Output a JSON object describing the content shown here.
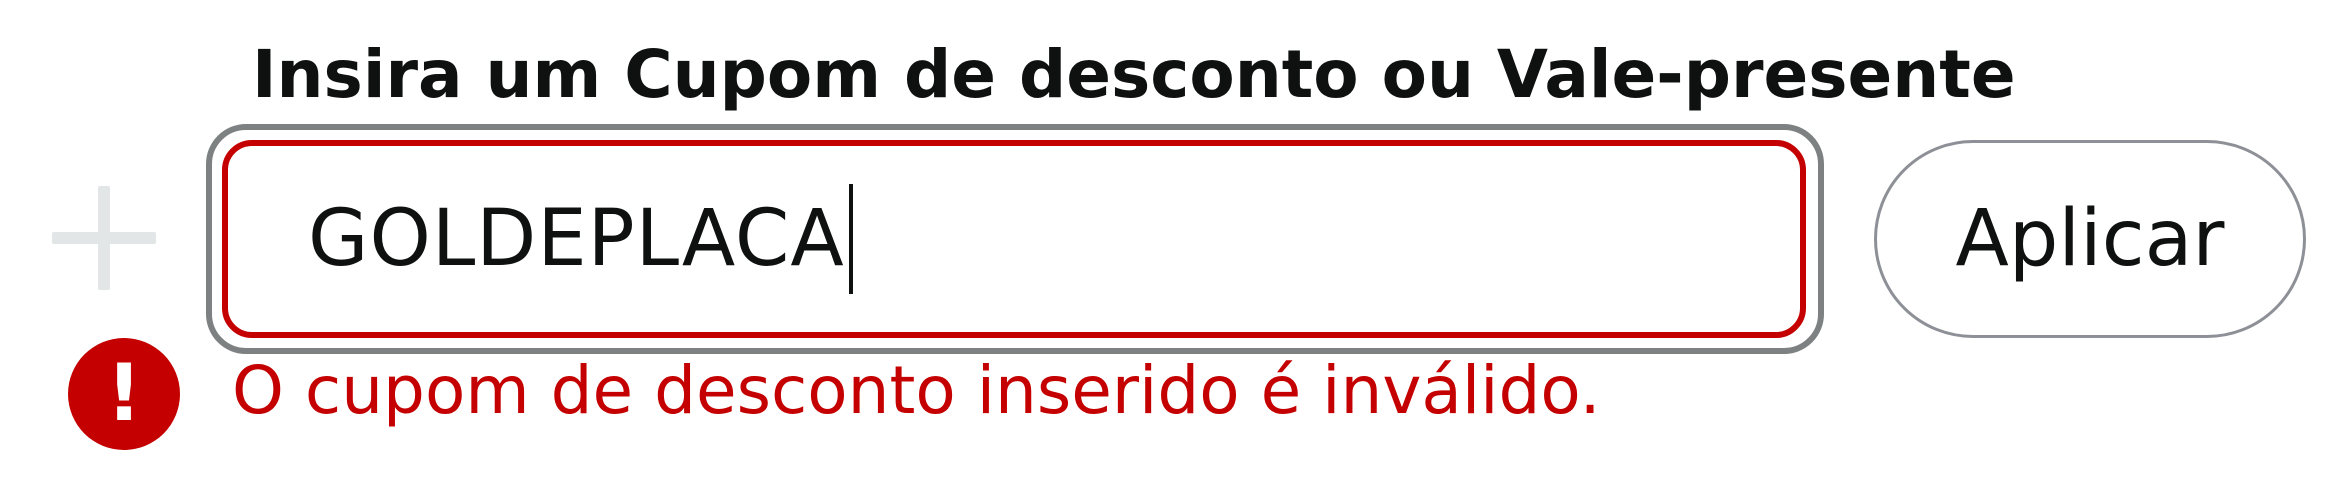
{
  "coupon_form": {
    "heading": "Insira um Cupom de desconto ou Vale-presente",
    "input_value": "GOLDEPLACA",
    "apply_label": "Aplicar",
    "error_message": "O cupom de desconto inserido é inválido.",
    "error_icon_glyph": "!"
  },
  "icons": {
    "expand": "plus-icon",
    "error": "error-alert-icon"
  },
  "colors": {
    "error": "#c40000",
    "text": "#0f1111",
    "focus_ring": "#7d8182",
    "button_border": "#8d9096",
    "disabled_icon": "#e3e6e6"
  }
}
